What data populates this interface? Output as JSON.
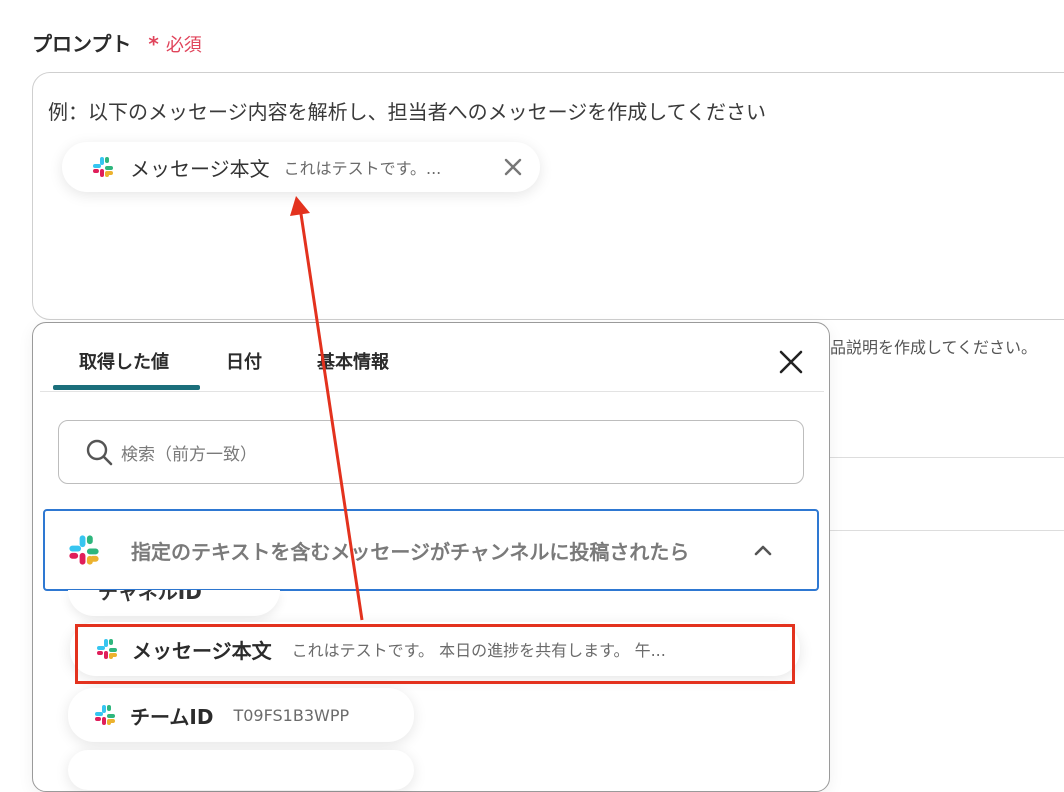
{
  "field": {
    "label": "プロンプト",
    "required_star": "*",
    "required_text": "必須"
  },
  "prompt": {
    "text": "例：以下のメッセージ内容を解析し、担当者へのメッセージを作成してください",
    "chip": {
      "title": "メッセージ本文",
      "value": "これはテストです。...",
      "icon": "slack-icon",
      "remove_icon": "close-icon"
    }
  },
  "background": {
    "hint": "品説明を作成してください。"
  },
  "picker": {
    "tabs": [
      {
        "label": "取得した値",
        "active": true
      },
      {
        "label": "日付",
        "active": false
      },
      {
        "label": "基本情報",
        "active": false
      }
    ],
    "search": {
      "placeholder": "検索（前方一致）",
      "icon": "search-icon"
    },
    "group": {
      "title": "指定のテキストを含むメッセージがチャンネルに投稿されたら",
      "expanded": true,
      "chevron": "chevron-up-icon"
    },
    "items": [
      {
        "title": "チャネルID",
        "value": ""
      },
      {
        "title": "メッセージ本文",
        "value": "これはテストです。 本日の進捗を共有します。 午..."
      },
      {
        "title": "チームID",
        "value": "T09FS1B3WPP"
      },
      {
        "title": "",
        "value": ""
      }
    ]
  },
  "annotation": {
    "highlight_color": "#e3321e",
    "arrow_color": "#e3321e"
  },
  "colors": {
    "required": "#e0445b",
    "tab_underline": "#1b6f7b",
    "group_border": "#2e78d2"
  }
}
